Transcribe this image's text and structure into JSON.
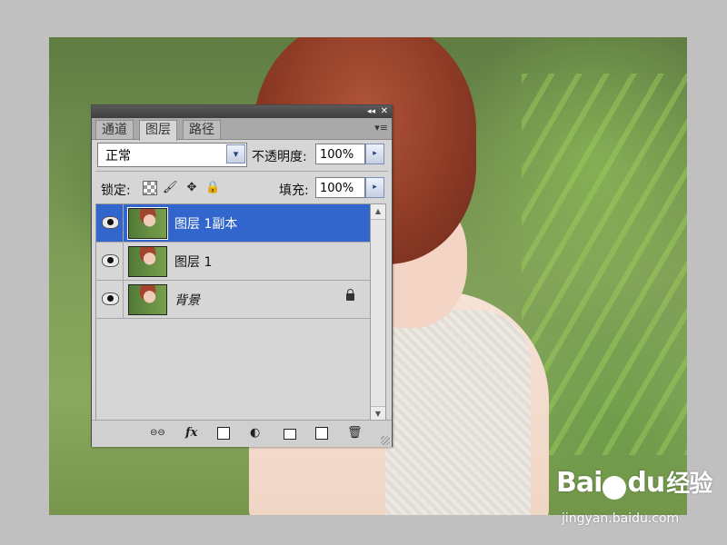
{
  "panel": {
    "titlebar": {
      "collapse_glyph": "◂◂",
      "close_glyph": "✕"
    },
    "tabs": [
      {
        "label": "通道",
        "active": false
      },
      {
        "label": "图层",
        "active": true
      },
      {
        "label": "路径",
        "active": false
      }
    ],
    "tab_menu_glyph": "▾≡",
    "blend_mode": {
      "value": "正常",
      "arrow": "▾"
    },
    "opacity": {
      "label": "不透明度:",
      "value": "100%",
      "arrow": "▸"
    },
    "lock": {
      "label": "锁定:"
    },
    "fill": {
      "label": "填充:",
      "value": "100%",
      "arrow": "▸"
    },
    "layers": [
      {
        "name": "图层 1副本",
        "selected": true,
        "visible": true,
        "locked": false,
        "italic": false
      },
      {
        "name": "图层 1",
        "selected": false,
        "visible": true,
        "locked": false,
        "italic": false
      },
      {
        "name": "背景",
        "selected": false,
        "visible": true,
        "locked": true,
        "italic": true
      }
    ],
    "scroll": {
      "up": "▲",
      "down": "▼"
    },
    "bottom_icons": {
      "link": "⊖⊖",
      "fx": "fx",
      "adjust": "◐"
    }
  },
  "watermark": {
    "logo_left": "Bai",
    "logo_right": "du",
    "logo_cn": "经验",
    "url": "jingyan.baidu.com"
  }
}
